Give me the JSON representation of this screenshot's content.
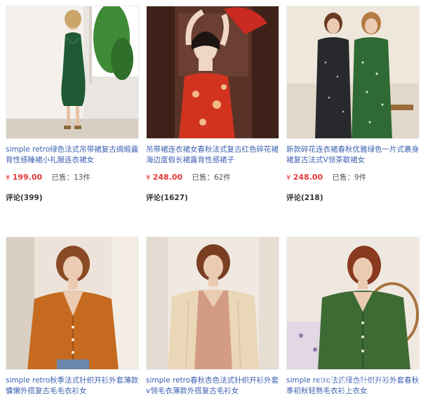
{
  "products": [
    {
      "title": "simple retro绿色法式吊带裙复古绸缎露背性感睡裙小礼服连衣裙女",
      "currency": "¥",
      "price": "199.00",
      "sold_label": "已售：",
      "sold_count": "13件",
      "review_label": "评论",
      "review_count": "(399)"
    },
    {
      "title": "吊带裙连衣裙女春秋法式复古红色碎花裙海边度假长裙露背性感裙子",
      "currency": "¥",
      "price": "248.00",
      "sold_label": "已售：",
      "sold_count": "62件",
      "review_label": "评论",
      "review_count": "(1627)"
    },
    {
      "title": "新款碎花连衣裙春秋优雅绿色一片式裹身裙复古法式V领茶歇裙女",
      "currency": "¥",
      "price": "248.00",
      "sold_label": "已售：",
      "sold_count": "9件",
      "review_label": "评论",
      "review_count": "(218)"
    },
    {
      "title": "simple retro秋季法式针织开衫外套薄款慵懒外搭复古毛毛衣衫女"
    },
    {
      "title": "simple retro春秋杏色法式针织开衫外套v领毛衣薄款外搭复古毛衫女"
    },
    {
      "title": "simple retro法式绿色针织开衫外套春秋季初秋轻熟毛衣衫上衣女"
    }
  ],
  "watermark": "知乎 @王威小草",
  "colors": {
    "link": "#3b5fb0",
    "price": "#e4393c"
  }
}
